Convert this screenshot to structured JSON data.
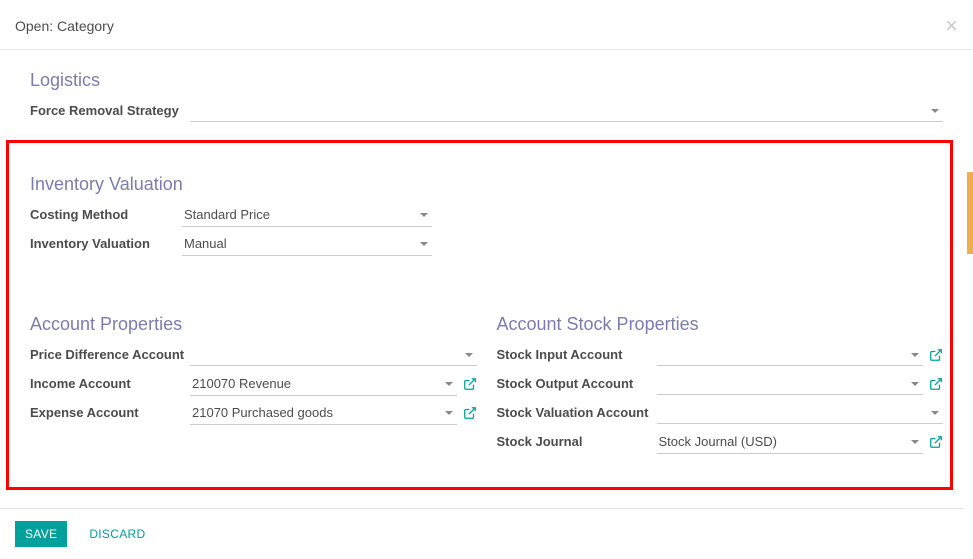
{
  "header": {
    "title": "Open: Category",
    "close": "×"
  },
  "logistics": {
    "heading": "Logistics",
    "force_removal_label": "Force Removal Strategy",
    "force_removal_value": ""
  },
  "inventory_valuation": {
    "heading": "Inventory Valuation",
    "costing_method_label": "Costing Method",
    "costing_method_value": "Standard Price",
    "inventory_valuation_label": "Inventory Valuation",
    "inventory_valuation_value": "Manual"
  },
  "account_properties": {
    "heading": "Account Properties",
    "price_diff_label": "Price Difference Account",
    "price_diff_value": "",
    "income_label": "Income Account",
    "income_value": "210070 Revenue",
    "expense_label": "Expense Account",
    "expense_value": "21070  Purchased goods"
  },
  "account_stock_properties": {
    "heading": "Account Stock Properties",
    "stock_input_label": "Stock Input Account",
    "stock_input_value": "",
    "stock_output_label": "Stock Output Account",
    "stock_output_value": "",
    "stock_valuation_label": "Stock Valuation Account",
    "stock_valuation_value": "",
    "stock_journal_label": "Stock Journal",
    "stock_journal_value": "Stock Journal (USD)"
  },
  "footer": {
    "save": "SAVE",
    "discard": "DISCARD"
  }
}
